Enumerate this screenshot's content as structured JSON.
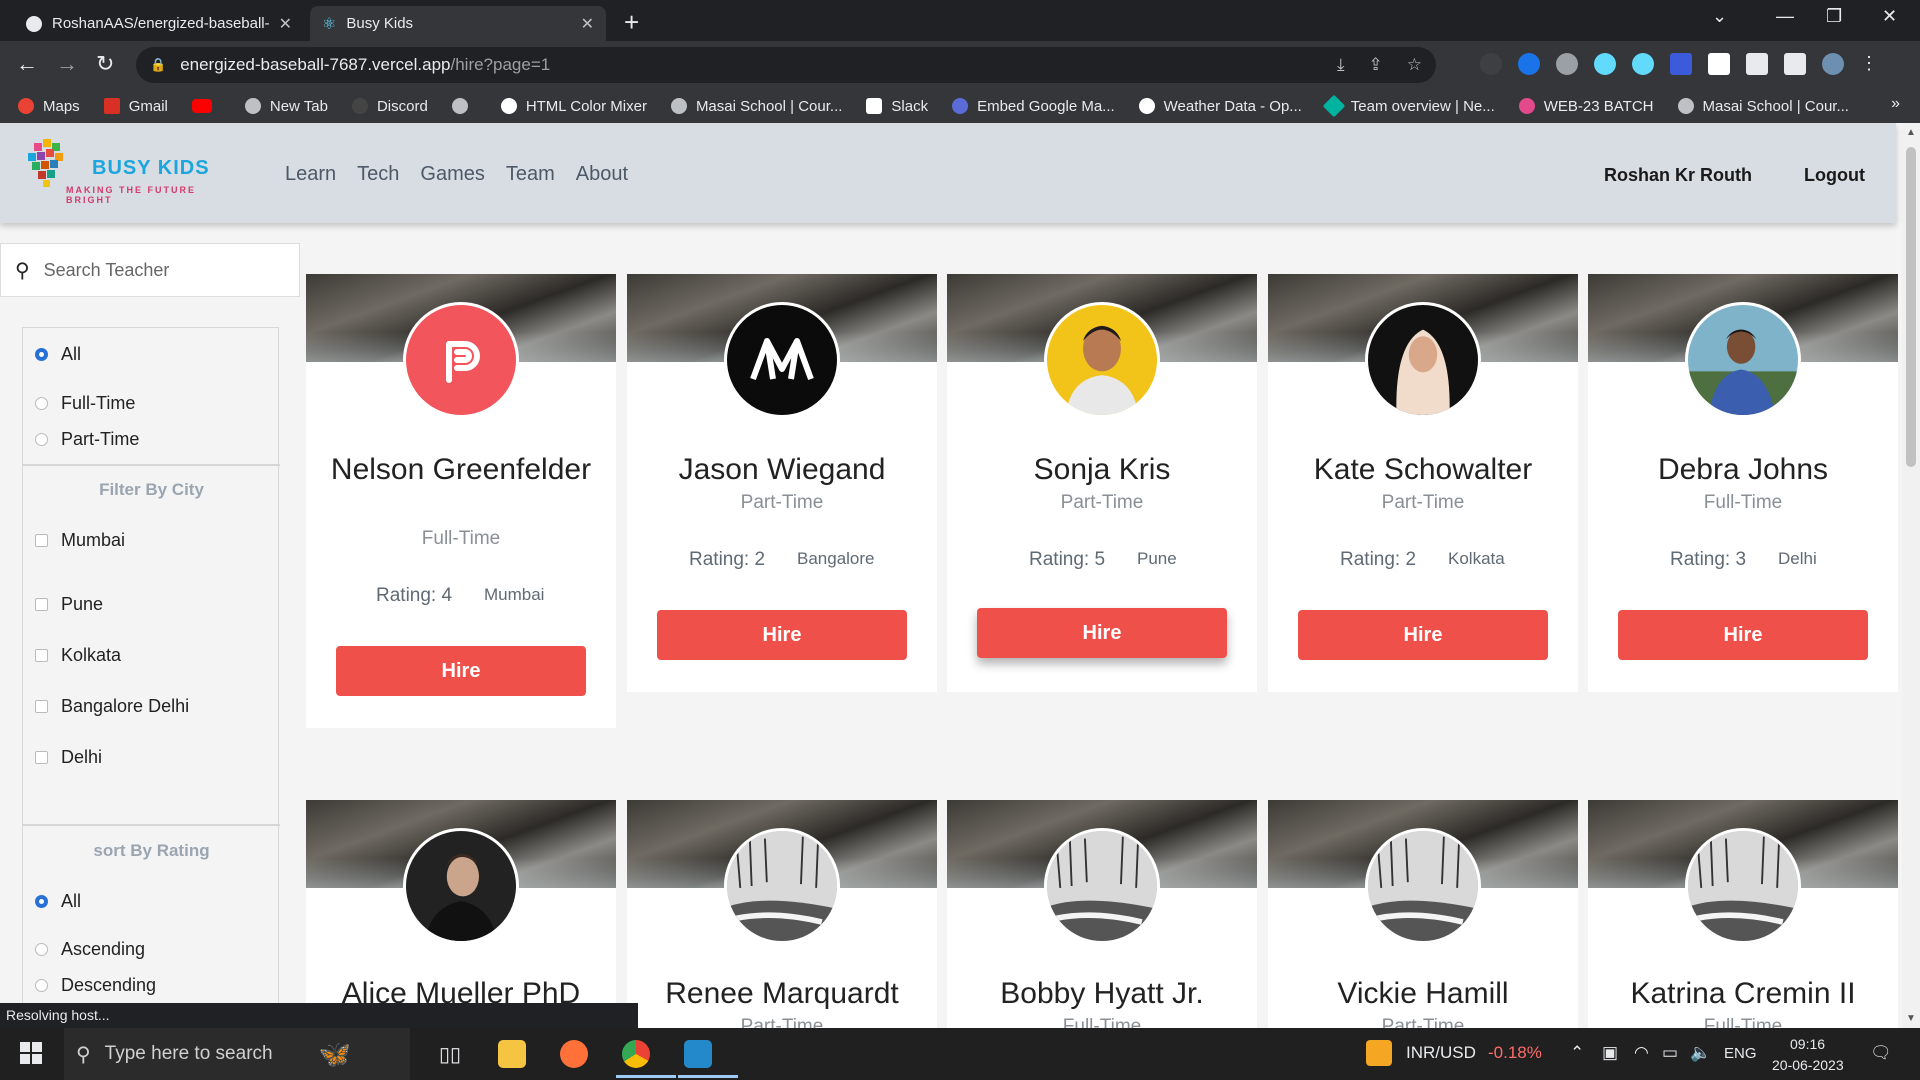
{
  "browser": {
    "tabs": [
      {
        "title": "RoshanAAS/energized-baseball-",
        "active": false
      },
      {
        "title": "Busy Kids",
        "active": true
      }
    ],
    "url_main": "energized-baseball-7687.vercel.app",
    "url_path": "/hire?page=1",
    "bookmarks": [
      {
        "label": "Maps",
        "color": "#ea4335"
      },
      {
        "label": "Gmail",
        "color": "#d93025"
      },
      {
        "label": "",
        "color": "#ff0000"
      },
      {
        "label": "New Tab",
        "color": "#bdc1c6"
      },
      {
        "label": "Discord",
        "color": "#444"
      },
      {
        "label": "",
        "color": "#bdc1c6"
      },
      {
        "label": "HTML Color Mixer",
        "color": "#fff"
      },
      {
        "label": "Masai School | Cour...",
        "color": "#bdc1c6"
      },
      {
        "label": "Slack",
        "color": "#fff"
      },
      {
        "label": "Embed Google Ma...",
        "color": "#5b6bd8"
      },
      {
        "label": "Weather Data - Op...",
        "color": "#fff"
      },
      {
        "label": "Team overview | Ne...",
        "color": "#00b3a1"
      },
      {
        "label": "WEB-23 BATCH",
        "color": "#e24a8b"
      },
      {
        "label": "Masai School | Cour...",
        "color": "#bdc1c6"
      }
    ],
    "status": "Resolving host..."
  },
  "header": {
    "logo_title": "BUSY KIDS",
    "logo_subtitle": "MAKING THE FUTURE BRIGHT",
    "nav": [
      "Learn",
      "Tech",
      "Games",
      "Team",
      "About"
    ],
    "user_name": "Roshan Kr Routh",
    "logout_label": "Logout"
  },
  "sidebar": {
    "search_placeholder": "Search Teacher",
    "type_options": [
      "All",
      "Full-Time",
      "Part-Time"
    ],
    "city_heading": "Filter By City",
    "cities": [
      "Mumbai",
      "Pune",
      "Kolkata",
      "Bangalore Delhi",
      "Delhi"
    ],
    "sort_heading": "sort By Rating",
    "sort_options": [
      "All",
      "Ascending",
      "Descending"
    ]
  },
  "teachers_row1": [
    {
      "name": "Nelson Greenfelder",
      "type": "Full-Time",
      "rating": "Rating: 4",
      "city": "Mumbai",
      "hire": "Hire",
      "avatar": "pabbly-logo"
    },
    {
      "name": "Jason Wiegand",
      "type": "Part-Time",
      "rating": "Rating: 2",
      "city": "Bangalore",
      "hire": "Hire",
      "avatar": "m-logo"
    },
    {
      "name": "Sonja Kris",
      "type": "Part-Time",
      "rating": "Rating: 5",
      "city": "Pune",
      "hire": "Hire",
      "avatar": "photo-yellow"
    },
    {
      "name": "Kate Schowalter",
      "type": "Part-Time",
      "rating": "Rating: 2",
      "city": "Kolkata",
      "hire": "Hire",
      "avatar": "photo-dark"
    },
    {
      "name": "Debra Johns",
      "type": "Full-Time",
      "rating": "Rating: 3",
      "city": "Delhi",
      "hire": "Hire",
      "avatar": "photo-outdoor"
    }
  ],
  "teachers_row2": [
    {
      "name": "Alice Mueller PhD",
      "type": "",
      "avatar": "photo-man"
    },
    {
      "name": "Renee Marquardt",
      "type": "Part-Time",
      "avatar": "photo-snow"
    },
    {
      "name": "Bobby Hyatt Jr.",
      "type": "Full-Time",
      "avatar": "photo-snow"
    },
    {
      "name": "Vickie Hamill",
      "type": "Part-Time",
      "avatar": "photo-snow"
    },
    {
      "name": "Katrina Cremin II",
      "type": "Full-Time",
      "avatar": "photo-snow"
    }
  ],
  "taskbar": {
    "search_placeholder": "Type here to search",
    "currency_label": "INR/USD",
    "currency_change": "-0.18%",
    "lang": "ENG",
    "time": "09:16",
    "date": "20-06-2023"
  },
  "colors": {
    "hire_button": "#f0504a",
    "header_bg": "#d7dde3",
    "radio_checked": "#2670d6"
  }
}
